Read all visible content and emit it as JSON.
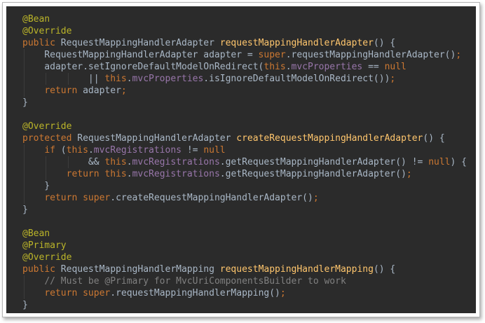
{
  "code_lines": [
    [
      {
        "t": "@Bean",
        "c": "ann"
      }
    ],
    [
      {
        "t": "@Override",
        "c": "ann"
      }
    ],
    [
      {
        "t": "public",
        "c": "kw"
      },
      {
        "t": " RequestMappingHandlerAdapter ",
        "c": "txt"
      },
      {
        "t": "requestMappingHandlerAdapter",
        "c": "fn"
      },
      {
        "t": "() {",
        "c": "txt"
      }
    ],
    [
      {
        "t": "    RequestMappingHandlerAdapter adapter = ",
        "c": "txt"
      },
      {
        "t": "super",
        "c": "kw"
      },
      {
        "t": ".requestMappingHandlerAdapter()",
        "c": "txt"
      },
      {
        "t": ";",
        "c": "kw"
      }
    ],
    [
      {
        "t": "    adapter.setIgnoreDefaultModelOnRedirect(",
        "c": "txt"
      },
      {
        "t": "this",
        "c": "kw"
      },
      {
        "t": ".",
        "c": "txt"
      },
      {
        "t": "mvcProperties",
        "c": "fld"
      },
      {
        "t": " == ",
        "c": "txt"
      },
      {
        "t": "null",
        "c": "kw"
      }
    ],
    [
      {
        "t": "            || ",
        "c": "txt"
      },
      {
        "t": "this",
        "c": "kw"
      },
      {
        "t": ".",
        "c": "txt"
      },
      {
        "t": "mvcProperties",
        "c": "fld"
      },
      {
        "t": ".isIgnoreDefaultModelOnRedirect())",
        "c": "txt"
      },
      {
        "t": ";",
        "c": "kw"
      }
    ],
    [
      {
        "t": "    ",
        "c": "txt"
      },
      {
        "t": "return",
        "c": "kw"
      },
      {
        "t": " adapter",
        "c": "txt"
      },
      {
        "t": ";",
        "c": "kw"
      }
    ],
    [
      {
        "t": "}",
        "c": "txt"
      }
    ],
    [],
    [
      {
        "t": "@Override",
        "c": "ann"
      }
    ],
    [
      {
        "t": "protected",
        "c": "kw"
      },
      {
        "t": " RequestMappingHandlerAdapter ",
        "c": "txt"
      },
      {
        "t": "createRequestMappingHandlerAdapter",
        "c": "fn"
      },
      {
        "t": "() {",
        "c": "txt"
      }
    ],
    [
      {
        "t": "    ",
        "c": "txt"
      },
      {
        "t": "if",
        "c": "kw"
      },
      {
        "t": " (",
        "c": "txt"
      },
      {
        "t": "this",
        "c": "kw"
      },
      {
        "t": ".",
        "c": "txt"
      },
      {
        "t": "mvcRegistrations",
        "c": "fld"
      },
      {
        "t": " != ",
        "c": "txt"
      },
      {
        "t": "null",
        "c": "kw"
      }
    ],
    [
      {
        "t": "            && ",
        "c": "txt"
      },
      {
        "t": "this",
        "c": "kw"
      },
      {
        "t": ".",
        "c": "txt"
      },
      {
        "t": "mvcRegistrations",
        "c": "fld"
      },
      {
        "t": ".getRequestMappingHandlerAdapter() != ",
        "c": "txt"
      },
      {
        "t": "null",
        "c": "kw"
      },
      {
        "t": ") {",
        "c": "txt"
      }
    ],
    [
      {
        "t": "        ",
        "c": "txt"
      },
      {
        "t": "return",
        "c": "kw"
      },
      {
        "t": " ",
        "c": "txt"
      },
      {
        "t": "this",
        "c": "kw"
      },
      {
        "t": ".",
        "c": "txt"
      },
      {
        "t": "mvcRegistrations",
        "c": "fld"
      },
      {
        "t": ".getRequestMappingHandlerAdapter()",
        "c": "txt"
      },
      {
        "t": ";",
        "c": "kw"
      }
    ],
    [
      {
        "t": "    }",
        "c": "txt"
      }
    ],
    [
      {
        "t": "    ",
        "c": "txt"
      },
      {
        "t": "return",
        "c": "kw"
      },
      {
        "t": " ",
        "c": "txt"
      },
      {
        "t": "super",
        "c": "kw"
      },
      {
        "t": ".createRequestMappingHandlerAdapter()",
        "c": "txt"
      },
      {
        "t": ";",
        "c": "kw"
      }
    ],
    [
      {
        "t": "}",
        "c": "txt"
      }
    ],
    [],
    [
      {
        "t": "@Bean",
        "c": "ann"
      }
    ],
    [
      {
        "t": "@Primary",
        "c": "ann"
      }
    ],
    [
      {
        "t": "@Override",
        "c": "ann"
      }
    ],
    [
      {
        "t": "public",
        "c": "kw"
      },
      {
        "t": " RequestMappingHandlerMapping ",
        "c": "txt"
      },
      {
        "t": "requestMappingHandlerMapping",
        "c": "fn"
      },
      {
        "t": "() {",
        "c": "txt"
      }
    ],
    [
      {
        "t": "    ",
        "c": "txt"
      },
      {
        "t": "// Must be @Primary for MvcUriComponentsBuilder to work",
        "c": "cmt"
      }
    ],
    [
      {
        "t": "    ",
        "c": "txt"
      },
      {
        "t": "return",
        "c": "kw"
      },
      {
        "t": " ",
        "c": "txt"
      },
      {
        "t": "super",
        "c": "kw"
      },
      {
        "t": ".requestMappingHandlerMapping()",
        "c": "txt"
      },
      {
        "t": ";",
        "c": "kw"
      }
    ],
    [
      {
        "t": "}",
        "c": "txt"
      }
    ]
  ],
  "colors": {
    "background": "#2b2b2b",
    "annotation": "#bbb529",
    "keyword": "#cc7832",
    "method_name": "#ffc66d",
    "field": "#9876aa",
    "comment": "#808080",
    "text": "#a9b7c6"
  }
}
